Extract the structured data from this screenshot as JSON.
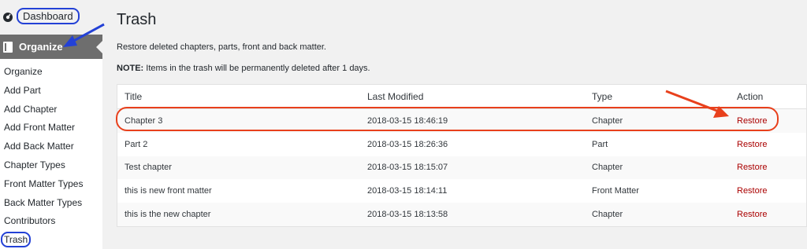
{
  "sidebar": {
    "dashboard_label": "Dashboard",
    "organize_label": "Organize",
    "items": [
      {
        "label": "Organize"
      },
      {
        "label": "Add Part"
      },
      {
        "label": "Add Chapter"
      },
      {
        "label": "Add Front Matter"
      },
      {
        "label": "Add Back Matter"
      },
      {
        "label": "Chapter Types"
      },
      {
        "label": "Front Matter Types"
      },
      {
        "label": "Back Matter Types"
      },
      {
        "label": "Contributors"
      },
      {
        "label": "Trash"
      }
    ]
  },
  "page": {
    "title": "Trash",
    "description": "Restore deleted chapters, parts, front and back matter.",
    "note_label": "NOTE:",
    "note_text": " Items in the trash will be permanently deleted after 1 days."
  },
  "table": {
    "headers": {
      "title": "Title",
      "modified": "Last Modified",
      "type": "Type",
      "action": "Action"
    },
    "rows": [
      {
        "title": "Chapter 3",
        "modified": "2018-03-15 18:46:19",
        "type": "Chapter",
        "action": "Restore"
      },
      {
        "title": "Part 2",
        "modified": "2018-03-15 18:26:36",
        "type": "Part",
        "action": "Restore"
      },
      {
        "title": "Test chapter",
        "modified": "2018-03-15 18:15:07",
        "type": "Chapter",
        "action": "Restore"
      },
      {
        "title": "this is new front matter",
        "modified": "2018-03-15 18:14:11",
        "type": "Front Matter",
        "action": "Restore"
      },
      {
        "title": "this is the new chapter",
        "modified": "2018-03-15 18:13:58",
        "type": "Chapter",
        "action": "Restore"
      }
    ]
  },
  "colors": {
    "action_link": "#aa0000",
    "annotation_blue": "#2341d6",
    "annotation_red": "#e8401c"
  }
}
